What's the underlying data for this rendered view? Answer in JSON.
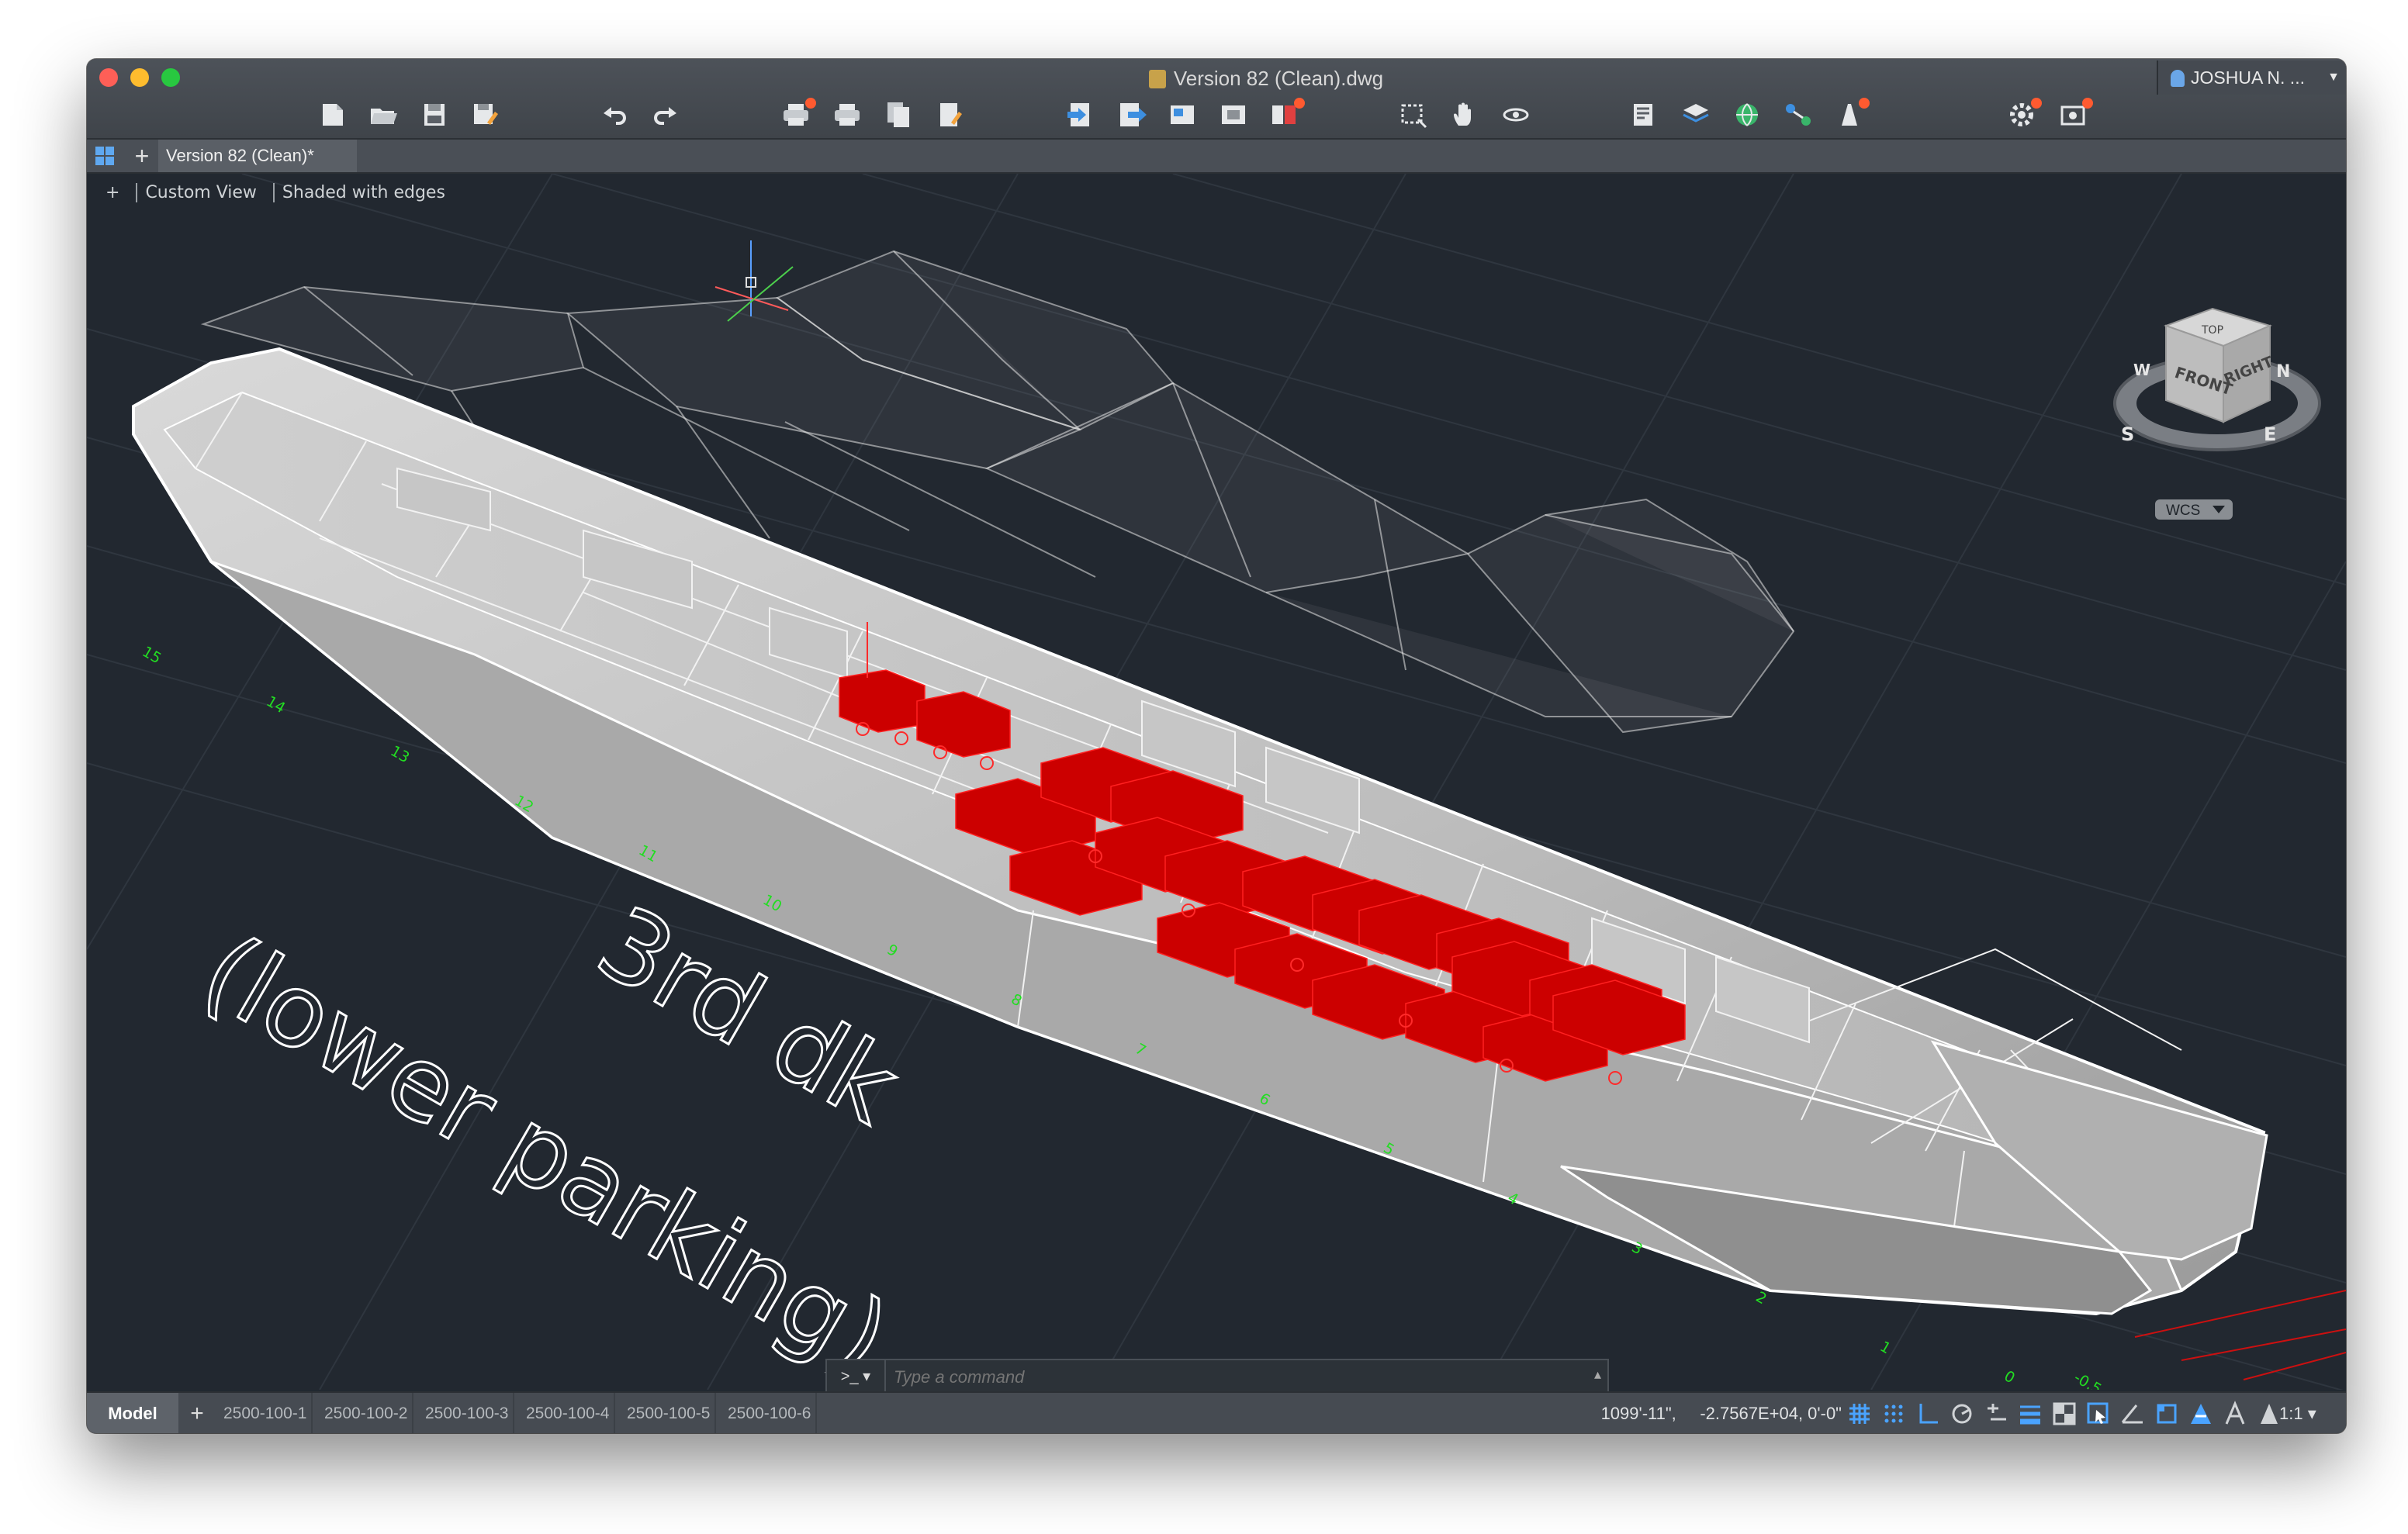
{
  "window": {
    "title": "Version 82 (Clean).dwg",
    "user": "JOSHUA N. ...",
    "traffic_colors": [
      "#fe5f57",
      "#febc2e",
      "#28c840"
    ]
  },
  "toolbar": {
    "icons": [
      "new-icon",
      "open-icon",
      "save-icon",
      "save-as-icon",
      "undo-icon",
      "redo-icon",
      "plot-icon",
      "batch-plot-icon",
      "publish-icon",
      "page-setup-icon",
      "import-icon",
      "export-icon",
      "attach-icon",
      "xref-icon",
      "layout-icon",
      "window-select-icon",
      "pan-icon",
      "orbit-icon",
      "properties-icon",
      "layers-icon",
      "globe-icon",
      "share-icon",
      "bulb-icon",
      "settings-icon",
      "render-icon"
    ]
  },
  "tabs": {
    "document_tab": "Version 82 (Clean)*"
  },
  "viewport": {
    "view_plus": "+",
    "view_name": "Custom View",
    "visual_style": "Shaded with edges",
    "deck_text_line1": "3rd dk",
    "deck_text_line2": "(lower parking)",
    "frame_numbers": [
      "15",
      "14",
      "13",
      "12",
      "11",
      "10",
      "9",
      "8",
      "7",
      "6",
      "5",
      "4",
      "3",
      "2",
      "1",
      "0",
      "-0.5"
    ],
    "viewcube": {
      "top": "TOP",
      "front": "FRONT",
      "right": "RIGHT",
      "north": "N",
      "south": "S",
      "east": "E",
      "west": "W",
      "wcs": "WCS"
    },
    "colors": {
      "background": "#222830",
      "accent": "#d40000",
      "grid": "#2e353e",
      "frame_label": "#22dd22"
    }
  },
  "command": {
    "prompt": ">_ ▾",
    "placeholder": "Type a command",
    "arrow": "▴"
  },
  "status": {
    "model": "Model",
    "add_layout": "+",
    "layouts": [
      "2500-100-1",
      "2500-100-2",
      "2500-100-3",
      "2500-100-4",
      "2500-100-5",
      "2500-100-6"
    ],
    "coords": "1099'-11\",     -2.7567E+04, 0'-0\"",
    "scale": "1:1 ▾",
    "icons": [
      "grid-icon",
      "snap-icon",
      "ortho-icon",
      "polar-icon",
      "osnap-icon",
      "lineweight-icon",
      "transparency-icon",
      "selection-cycling-icon",
      "dynamic-ucs-icon",
      "isoplane-icon",
      "annotation-monitor-icon",
      "annotation-visibility-icon",
      "auto-scale-icon",
      "workspace-icon",
      "customize-icon"
    ]
  }
}
